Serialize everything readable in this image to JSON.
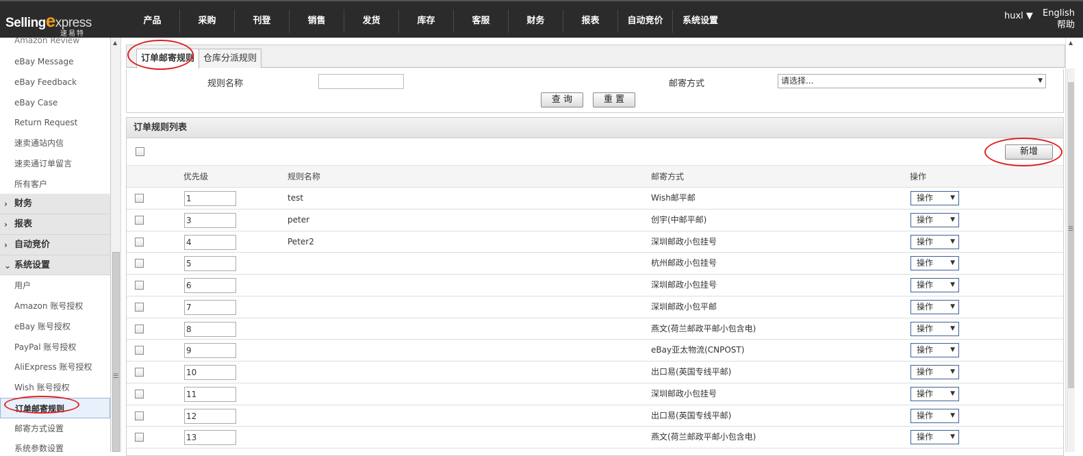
{
  "brand": {
    "logo_text_1": "Selling",
    "logo_e": "e",
    "logo_text_2": "xpress",
    "logo_cn": "速易特"
  },
  "nav": [
    "产品",
    "采购",
    "刊登",
    "销售",
    "发货",
    "库存",
    "客服",
    "财务",
    "报表",
    "自动竞价",
    "系统设置"
  ],
  "user": {
    "name": "huxl ▼"
  },
  "lang": {
    "english": "English",
    "help": "帮助"
  },
  "sidebar": {
    "top_items": [
      "Amazon Review",
      "eBay Message",
      "eBay Feedback",
      "eBay Case",
      "Return Request",
      "速卖通站内信",
      "速卖通订单留言",
      "所有客户"
    ],
    "groups": [
      {
        "label": "财务",
        "chev": "›"
      },
      {
        "label": "报表",
        "chev": "›"
      },
      {
        "label": "自动竞价",
        "chev": "›"
      },
      {
        "label": "系统设置",
        "chev": "⌄"
      }
    ],
    "sys_items": [
      "用户",
      "Amazon 账号授权",
      "eBay 账号授权",
      "PayPal 账号授权",
      "AliExpress 账号授权",
      "Wish 账号授权",
      "订单邮寄规则",
      "邮寄方式设置",
      "系统参数设置"
    ]
  },
  "tabs": {
    "active": "订单邮寄规则",
    "second": "仓库分派规则"
  },
  "search": {
    "rule_name_label": "规则名称",
    "rule_name_value": "",
    "ship_label": "邮寄方式",
    "ship_selected": "请选择...",
    "query_button": "查 询",
    "reset_button": "重 置"
  },
  "list": {
    "title": "订单规则列表",
    "add_button": "新增",
    "columns": {
      "priority": "优先级",
      "name": "规则名称",
      "shipping": "邮寄方式",
      "action": "操作"
    },
    "rows": [
      {
        "priority": "1",
        "name": "test",
        "shipping": "Wish邮平邮",
        "action": "操作"
      },
      {
        "priority": "3",
        "name": "peter",
        "shipping": "创宇(中邮平邮)",
        "action": "操作"
      },
      {
        "priority": "4",
        "name": "Peter2",
        "shipping": "深圳邮政小包挂号",
        "action": "操作"
      },
      {
        "priority": "5",
        "name": "",
        "shipping": "杭州邮政小包挂号",
        "action": "操作"
      },
      {
        "priority": "6",
        "name": "",
        "shipping": "深圳邮政小包挂号",
        "action": "操作"
      },
      {
        "priority": "7",
        "name": "",
        "shipping": "深圳邮政小包平邮",
        "action": "操作"
      },
      {
        "priority": "8",
        "name": "",
        "shipping": "燕文(荷兰邮政平邮小包含电)",
        "action": "操作"
      },
      {
        "priority": "9",
        "name": "",
        "shipping": "eBay亚太物流(CNPOST)",
        "action": "操作"
      },
      {
        "priority": "10",
        "name": "",
        "shipping": "出口易(英国专线平邮)",
        "action": "操作"
      },
      {
        "priority": "11",
        "name": "",
        "shipping": "深圳邮政小包挂号",
        "action": "操作"
      },
      {
        "priority": "12",
        "name": "",
        "shipping": "出口易(英国专线平邮)",
        "action": "操作"
      },
      {
        "priority": "13",
        "name": "",
        "shipping": "燕文(荷兰邮政平邮小包含电)",
        "action": "操作"
      }
    ]
  },
  "colors": {
    "topbar": "#2b2b2b",
    "accent": "#f39c12",
    "annotation": "#e02020"
  }
}
